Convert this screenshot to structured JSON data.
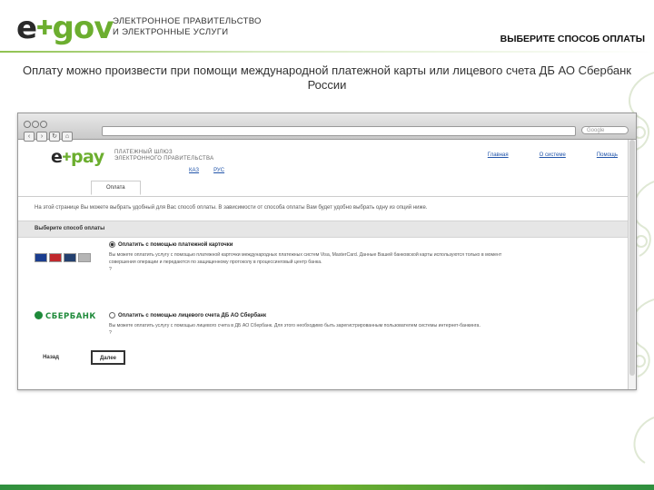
{
  "header": {
    "logo": {
      "e": "e",
      "gov": "gov"
    },
    "org_line1": "ЭЛЕКТРОННОЕ ПРАВИТЕЛЬСТВО",
    "org_line2": "И ЭЛЕКТРОННЫЕ УСЛУГИ",
    "step_title": "ВЫБЕРИТЕ СПОСОБ ОПЛАТЫ"
  },
  "lead_text": "Оплату можно произвести при помощи международной платежной карты или лицевого счета ДБ АО Сбербанк России",
  "browser": {
    "search_placeholder": "Google",
    "site": {
      "logo": {
        "e": "e",
        "pay": "pay"
      },
      "gateway_line1": "ПЛАТЕЖНЫЙ ШЛЮЗ",
      "gateway_line2": "ЭЛЕКТРОННОГО ПРАВИТЕЛЬСТВА",
      "langs": [
        "КАЗ",
        "РУС"
      ],
      "top_links": [
        "Главная",
        "О системе",
        "Помощь"
      ],
      "tab": "Оплата",
      "intro": "На этой странице Вы можете выбрать удобный для Вас способ оплаты. В зависимости от способа оплаты Вам будет удобно выбрать одну из опций ниже.",
      "choose_heading": "Выберите способ оплаты",
      "options": [
        {
          "title": "Оплатить с помощью платежной карточки",
          "selected": true,
          "desc": "Вы можете оплатить услугу с помощью платежной карточки международных платежных систем Visa, MasterCard. Данные Вашей банковской карты используются только в момент совершения операции и передаются по защищенному протоколу в процессинговый центр банка.",
          "link": "?"
        },
        {
          "title": "Оплатить с помощью лицевого счета ДБ АО Сбербанк",
          "selected": false,
          "desc": "Вы можете оплатить услугу с помощью лицевого счета в ДБ АО Сбербанк. Для этого необходимо быть зарегистрированным пользователем системы интернет-банкинга.",
          "link": "?",
          "bank_name": "СБЕРБАНК"
        }
      ],
      "buttons": {
        "back": "Назад",
        "next": "Далее"
      }
    }
  },
  "colors": {
    "accent_green": "#6cae2f",
    "sber_green": "#1e8a3a"
  }
}
